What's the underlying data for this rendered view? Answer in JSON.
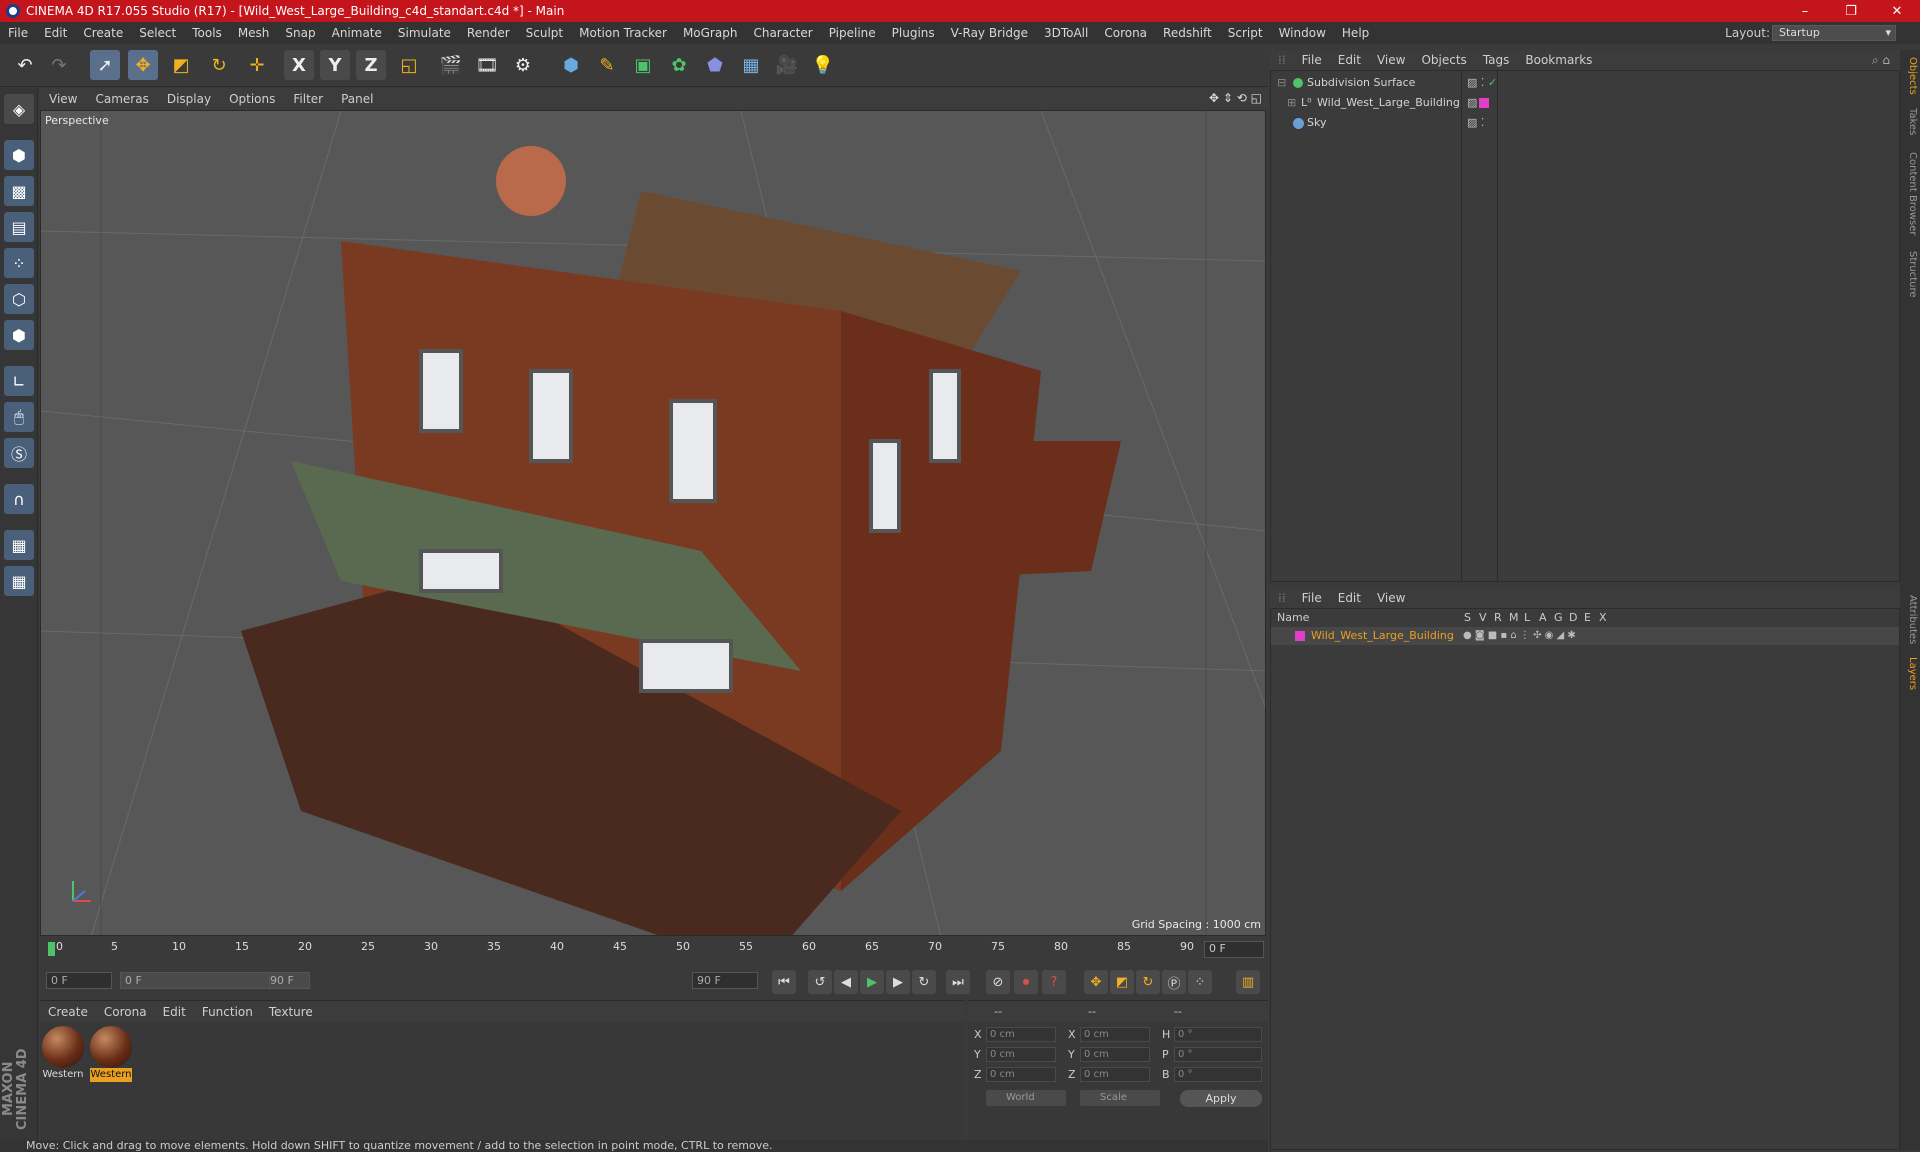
{
  "window": {
    "title": "CINEMA 4D R17.055 Studio (R17) - [Wild_West_Large_Building_c4d_standart.c4d *] - Main",
    "minimize": "–",
    "restore": "❐",
    "close": "✕"
  },
  "menu": [
    "File",
    "Edit",
    "Create",
    "Select",
    "Tools",
    "Mesh",
    "Snap",
    "Animate",
    "Simulate",
    "Render",
    "Sculpt",
    "Motion Tracker",
    "MoGraph",
    "Character",
    "Pipeline",
    "Plugins",
    "V-Ray Bridge",
    "3DToAll",
    "Corona",
    "Redshift",
    "Script",
    "Window",
    "Help"
  ],
  "layout": {
    "label": "Layout:",
    "value": "Startup"
  },
  "toolbar": {
    "x_label": "X",
    "y_label": "Y",
    "z_label": "Z"
  },
  "viewport": {
    "menu": [
      "View",
      "Cameras",
      "Display",
      "Options",
      "Filter",
      "Panel"
    ],
    "camera_label": "Perspective",
    "grid_spacing": "Grid Spacing : 1000 cm"
  },
  "timeline": {
    "ticks": [
      "0",
      "5",
      "10",
      "15",
      "20",
      "25",
      "30",
      "35",
      "40",
      "45",
      "50",
      "55",
      "60",
      "65",
      "70",
      "75",
      "80",
      "85",
      "90"
    ],
    "current_frame": "0 F",
    "start_field": "0 F",
    "slider_start": "0 F",
    "slider_end": "90 F",
    "end_field": "90 F"
  },
  "materials": {
    "menu": [
      "Create",
      "Corona",
      "Edit",
      "Function",
      "Texture"
    ],
    "items": [
      {
        "name": "Western"
      },
      {
        "name": "Western"
      }
    ]
  },
  "coordinates": {
    "header": [
      "--",
      "--",
      "--"
    ],
    "rows": [
      {
        "axis": "X",
        "pos": "0 cm",
        "axis2": "X",
        "size": "0 cm",
        "rot_label": "H",
        "rot": "0 °"
      },
      {
        "axis": "Y",
        "pos": "0 cm",
        "axis2": "Y",
        "size": "0 cm",
        "rot_label": "P",
        "rot": "0 °"
      },
      {
        "axis": "Z",
        "pos": "0 cm",
        "axis2": "Z",
        "size": "0 cm",
        "rot_label": "B",
        "rot": "0 °"
      }
    ],
    "mode": "World",
    "scale": "Scale",
    "apply": "Apply"
  },
  "status": "Move: Click and drag to move elements. Hold down SHIFT to quantize movement / add to the selection in point mode, CTRL to remove.",
  "objects": {
    "menu": [
      "File",
      "Edit",
      "View",
      "Objects",
      "Tags",
      "Bookmarks"
    ],
    "items": [
      {
        "name": "Subdivision Surface",
        "color": "#4fc36a"
      },
      {
        "name": "Wild_West_Large_Building",
        "color": "#e040c8"
      },
      {
        "name": "Sky",
        "color": "#6aa0d8"
      }
    ]
  },
  "layers": {
    "menu": [
      "File",
      "Edit",
      "View"
    ],
    "columns": [
      "Name",
      "S",
      "V",
      "R",
      "M",
      "L",
      "A",
      "G",
      "D",
      "E",
      "X"
    ],
    "items": [
      {
        "name": "Wild_West_Large_Building",
        "color": "#e040c8"
      }
    ]
  },
  "side_tabs": [
    "Objects",
    "Takes",
    "Content Browser",
    "Structure",
    "Attributes",
    "Layers"
  ],
  "brand": "MAXON CINEMA 4D",
  "colors": {
    "title_bar": "#c4141c",
    "accent": "#e8a020",
    "selected_tool": "#5a6f8c"
  }
}
